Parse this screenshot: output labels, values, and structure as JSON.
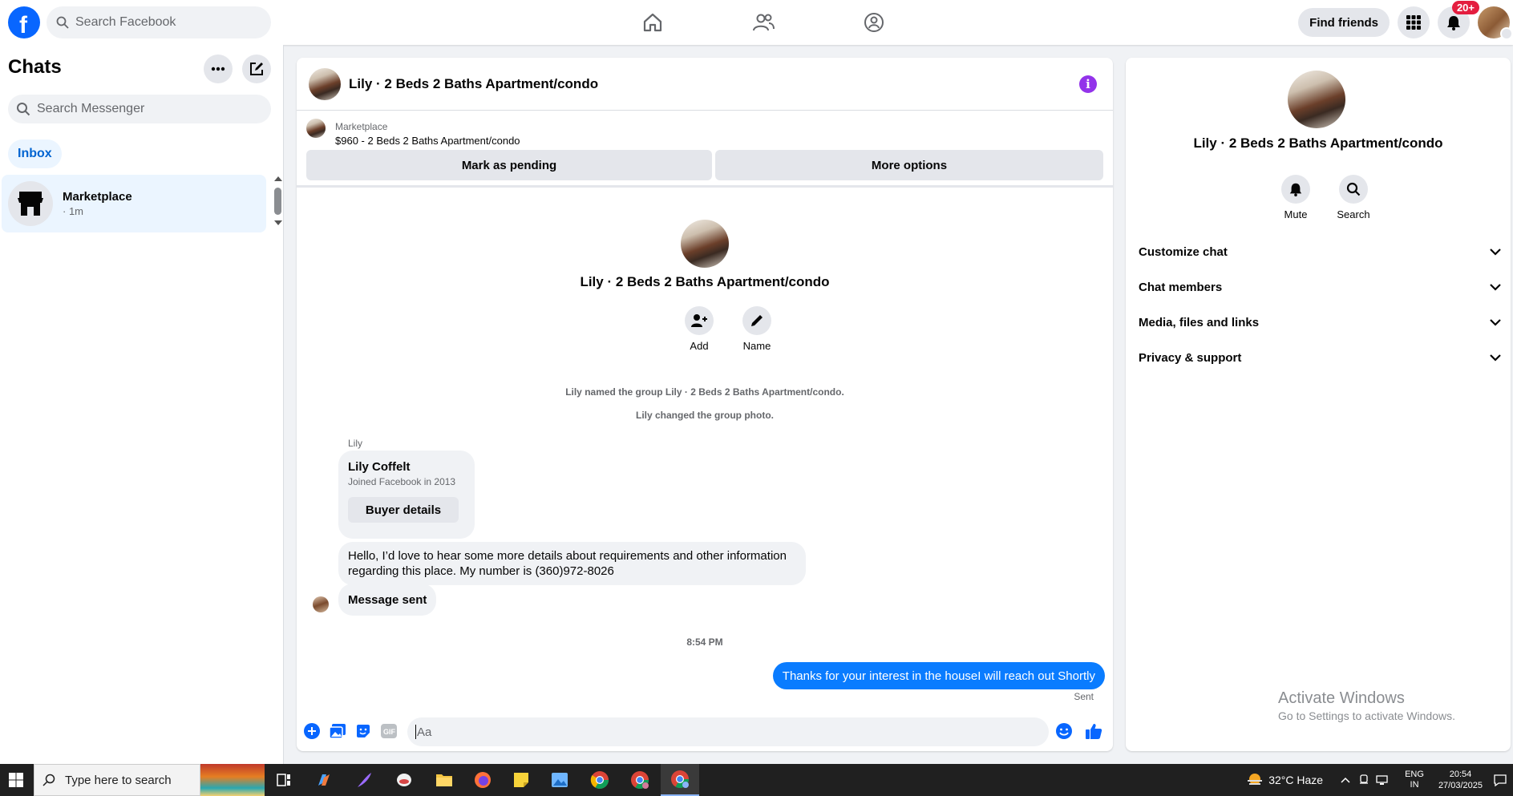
{
  "topbar": {
    "search_placeholder": "Search Facebook",
    "find_friends": "Find friends",
    "notif_count": "20+"
  },
  "sidebar": {
    "title": "Chats",
    "search_placeholder": "Search Messenger",
    "filter_tab": "Inbox",
    "chats": [
      {
        "name": "Marketplace",
        "time": "· 1m",
        "icon": "storefront-icon"
      }
    ]
  },
  "chat": {
    "title": "Lily · 2 Beds 2 Baths Apartment/condo",
    "marketplace_label": "Marketplace",
    "listing": "$960 - 2 Beds 2 Baths Apartment/condo",
    "mark_pending": "Mark as pending",
    "more_options": "More options",
    "group_name": "Lily · 2 Beds 2 Baths Apartment/condo",
    "add_label": "Add",
    "name_label": "Name",
    "system_messages": [
      "Lily named the group Lily · 2 Beds 2 Baths Apartment/condo.",
      "Lily changed the group photo."
    ],
    "sender": "Lily",
    "card": {
      "name": "Lily Coffelt",
      "subtitle": "Joined Facebook in 2013",
      "button": "Buyer details"
    },
    "incoming_message_line1": "Hello, I’d love to hear some more details about requirements and other information",
    "incoming_message_line2": "regarding this place. My number is (360)972-8026",
    "status_message": "Message sent",
    "time_separator": "8:54 PM",
    "outgoing_message": "Thanks for your interest in the houseI will reach out Shortly",
    "sent_label": "Sent",
    "composer_placeholder": "Aa"
  },
  "info_panel": {
    "name": "Lily · 2 Beds 2 Baths Apartment/condo",
    "mute_label": "Mute",
    "search_label": "Search",
    "sections": [
      "Customize chat",
      "Chat members",
      "Media, files and links",
      "Privacy & support"
    ]
  },
  "watermark": {
    "line1": "Activate Windows",
    "line2": "Go to Settings to activate Windows."
  },
  "taskbar": {
    "search_placeholder": "Type here to search",
    "weather": "32°C  Haze",
    "lang_line1": "ENG",
    "lang_line2": "IN",
    "time": "20:54",
    "date": "27/03/2025"
  },
  "colors": {
    "brand": "#0866ff",
    "outgoing_bubble": "#0a7cff",
    "accent_purple": "#9333ea",
    "badge_red": "#e41e3f"
  }
}
